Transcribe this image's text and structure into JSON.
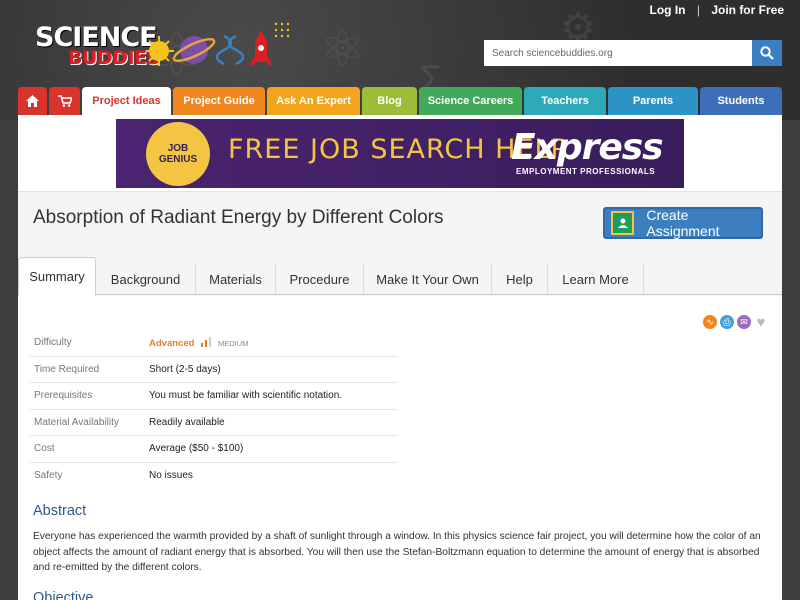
{
  "top_links": {
    "login": "Log In",
    "separator": "|",
    "join": "Join for Free"
  },
  "logo": {
    "line1": "SCIENCE",
    "line2": "BUDDIES"
  },
  "search": {
    "placeholder": "Search sciencebuddies.org"
  },
  "nav": {
    "items": [
      {
        "label": "",
        "icon": "home-icon",
        "color": "#d9342b"
      },
      {
        "label": "",
        "icon": "cart-icon",
        "color": "#d9342b"
      },
      {
        "label": "Project Ideas",
        "color": "#ffffff",
        "text_color": "#d9342b"
      },
      {
        "label": "Project Guide",
        "color": "#f0861e"
      },
      {
        "label": "Ask An Expert",
        "color": "#f2a51c"
      },
      {
        "label": "Blog",
        "color": "#9bbd37"
      },
      {
        "label": "Science Careers",
        "color": "#40a95a"
      },
      {
        "label": "Teachers",
        "color": "#2ea9b7"
      },
      {
        "label": "Parents",
        "color": "#2b93c6"
      },
      {
        "label": "Students",
        "color": "#3c6fb8"
      }
    ]
  },
  "ad": {
    "badge_line1": "JOB",
    "badge_line2": "GENIUS",
    "headline": "FREE JOB SEARCH HELP",
    "brand": "Express",
    "brand_sub": "EMPLOYMENT PROFESSIONALS"
  },
  "page": {
    "title": "Absorption of Radiant Energy by Different Colors",
    "create_assignment": "Create Assignment"
  },
  "tabs": [
    {
      "label": "Summary",
      "active": true
    },
    {
      "label": "Background"
    },
    {
      "label": "Materials"
    },
    {
      "label": "Procedure"
    },
    {
      "label": "Make It Your Own"
    },
    {
      "label": "Help"
    },
    {
      "label": "Learn More"
    }
  ],
  "specs": {
    "difficulty_label": "Difficulty",
    "difficulty_value": "Advanced",
    "difficulty_level": "MEDIUM",
    "rows": [
      {
        "label": "Time Required",
        "value": "Short (2-5 days)"
      },
      {
        "label": "Prerequisites",
        "value": "You must be familiar with scientific notation."
      },
      {
        "label": "Material Availability",
        "value": "Readily available"
      },
      {
        "label": "Cost",
        "value": "Average ($50 - $100)"
      },
      {
        "label": "Safety",
        "value": "No issues"
      }
    ]
  },
  "abstract": {
    "heading": "Abstract",
    "text": "Everyone has experienced the warmth provided by a shaft of sunlight through a window. In this physics science fair project, you will determine how the color of an object affects the amount of radiant energy that is absorbed. You will then use the Stefan-Boltzmann equation to determine the amount of energy that is absorbed and re-emitted by the different colors."
  },
  "objective": {
    "heading": "Objective"
  },
  "share_icons": [
    "share-icon",
    "print-icon",
    "email-icon",
    "favorite-icon"
  ]
}
